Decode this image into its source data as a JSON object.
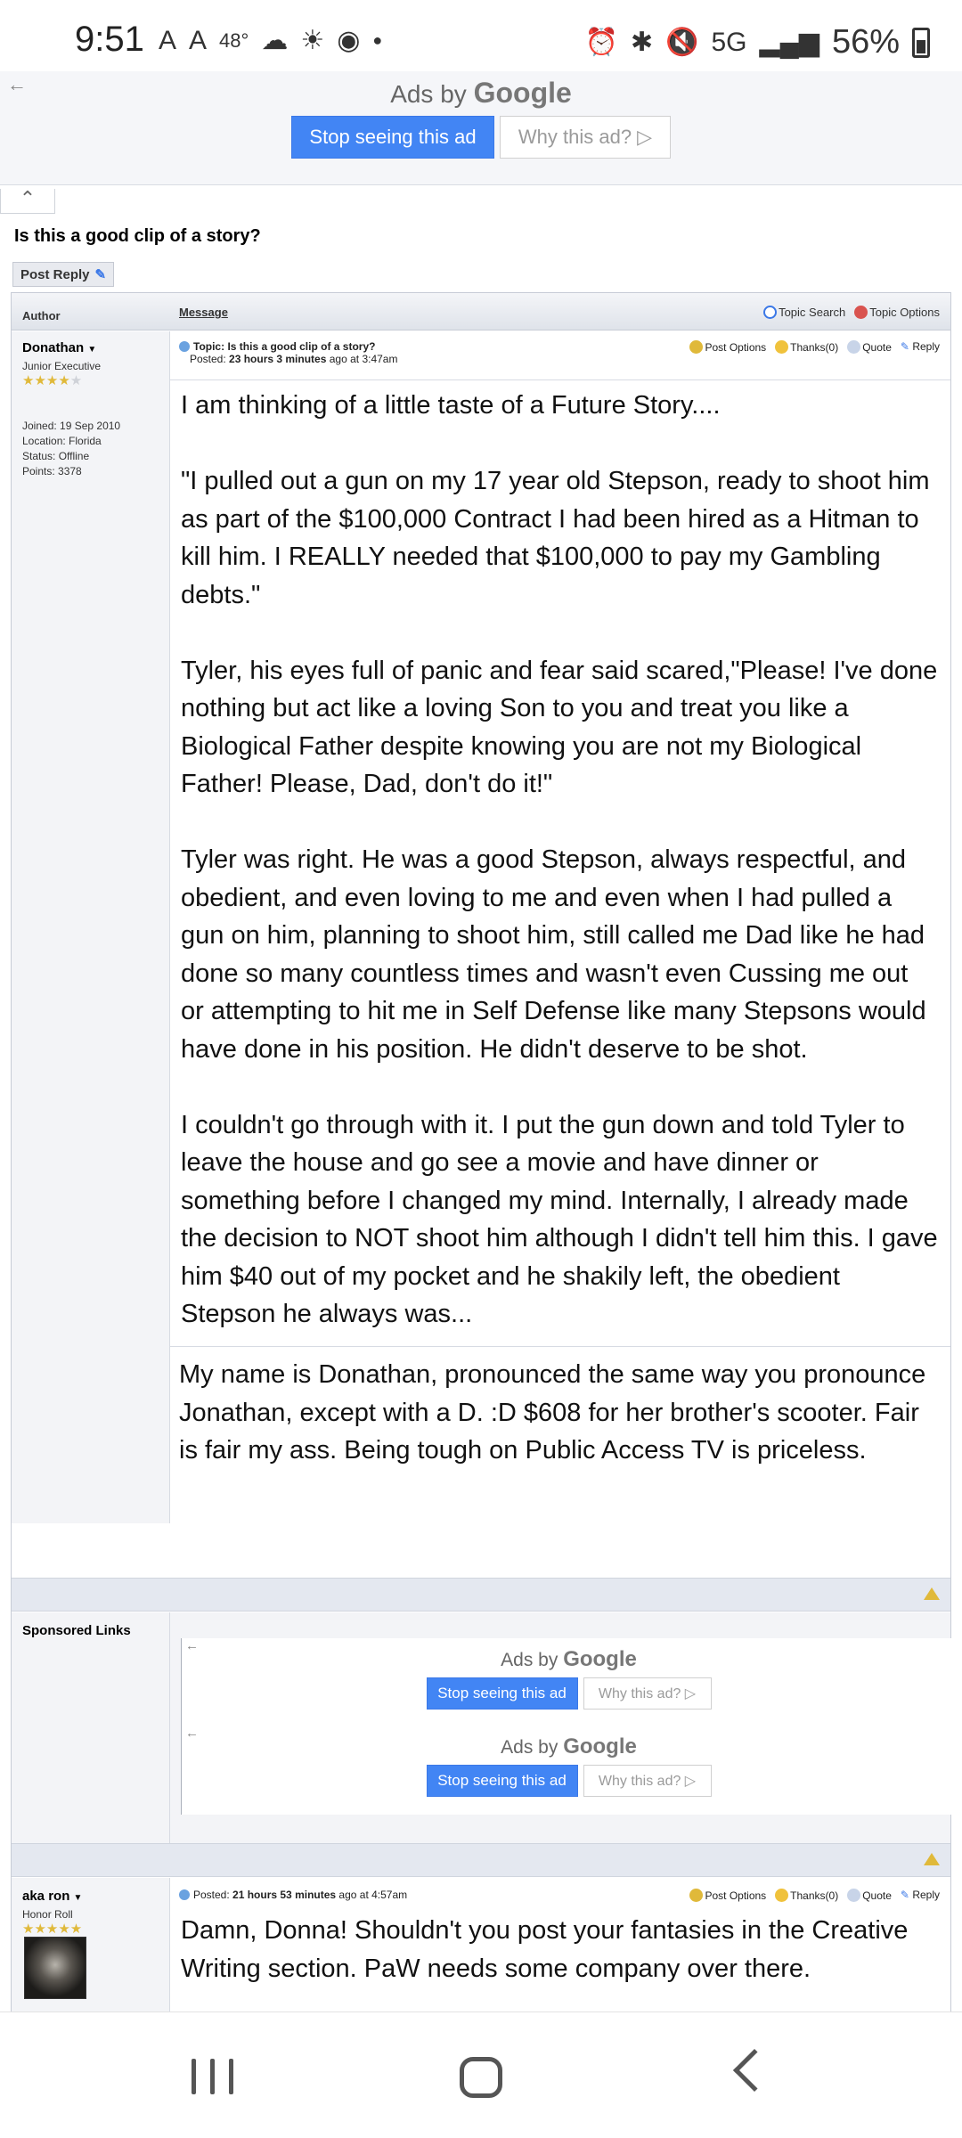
{
  "status_bar": {
    "time": "9:51",
    "left_icons": [
      "A",
      "A",
      "48°"
    ],
    "network": "5G",
    "battery": "56%"
  },
  "top_ad": {
    "ads_by": "Ads by",
    "google": "Google",
    "stop_label": "Stop seeing this ad",
    "why_label": "Why this ad? ▷"
  },
  "topic": {
    "title": "Is this a good clip of a story?",
    "post_reply": "Post Reply"
  },
  "table_header": {
    "author": "Author",
    "message": "Message",
    "topic_search": "Topic Search",
    "topic_options": "Topic Options"
  },
  "post1": {
    "author": "Donathan",
    "rank": "Junior Executive",
    "stars_filled": 4,
    "joined": "Joined: 19 Sep 2010",
    "location": "Location: Florida",
    "status": "Status: Offline",
    "points": "Points: 3378",
    "topic_line": "Topic: Is this a good clip of a story?",
    "posted_prefix": "Posted: ",
    "posted_time": "23 hours 3 minutes",
    "posted_suffix": " ago at 3:47am",
    "actions": [
      "Post Options",
      "Thanks(0)",
      "Quote",
      "Reply"
    ],
    "paragraphs": [
      "I am thinking of a little taste of a Future Story....",
      "\"I pulled out a gun on my 17 year old Stepson, ready to shoot him as part of the $100,000 Contract I had been hired as a Hitman to kill him. I REALLY needed that $100,000 to pay my Gambling debts.\"",
      "Tyler, his eyes full of panic and fear said scared,\"Please! I've done nothing but act like a loving Son to you and treat you like a Biological Father despite knowing you are not my Biological Father! Please, Dad, don't do it!\"",
      "Tyler was right. He was a good Stepson, always respectful, and obedient, and even loving to me and even when I had pulled a gun on him, planning to shoot him, still called me Dad like he had done so many countless times and wasn't even Cussing me out or attempting to hit me in Self Defense like many Stepsons would have done in his position. He didn't deserve to be shot.",
      "I couldn't go through with it. I put the gun down and told Tyler to leave the house and go see a movie and have dinner or something before I changed my mind. Internally, I already made the decision to NOT shoot him although I didn't tell him this. I gave him $40 out of my pocket and he shakily left, the obedient Stepson he always was..."
    ],
    "signature": "My name is Donathan, pronounced the same way you pronounce Jonathan, except with a D. :D $608 for her brother's scooter. Fair is fair my ass. Being tough on Public Access TV is priceless."
  },
  "sponsored": {
    "label": "Sponsored Links",
    "ads": [
      {
        "ads_by": "Ads by",
        "google": "Google",
        "stop_label": "Stop seeing this ad",
        "why_label": "Why this ad? ▷"
      },
      {
        "ads_by": "Ads by",
        "google": "Google",
        "stop_label": "Stop seeing this ad",
        "why_label": "Why this ad? ▷"
      }
    ]
  },
  "post2": {
    "author": "aka ron",
    "rank": "Honor Roll",
    "stars_filled": 5,
    "posted_prefix": "Posted: ",
    "posted_time": "21 hours 53 minutes",
    "posted_suffix": " ago at 4:57am",
    "actions": [
      "Post Options",
      "Thanks(0)",
      "Quote",
      "Reply"
    ],
    "body": "Damn, Donna!  Shouldn't you post your fantasies in the Creative Writing section. PaW needs some company over there."
  },
  "colors": {
    "google_blue": "#4285f4",
    "star": "#e0b93a",
    "row_bar": "#e4e8f0"
  }
}
